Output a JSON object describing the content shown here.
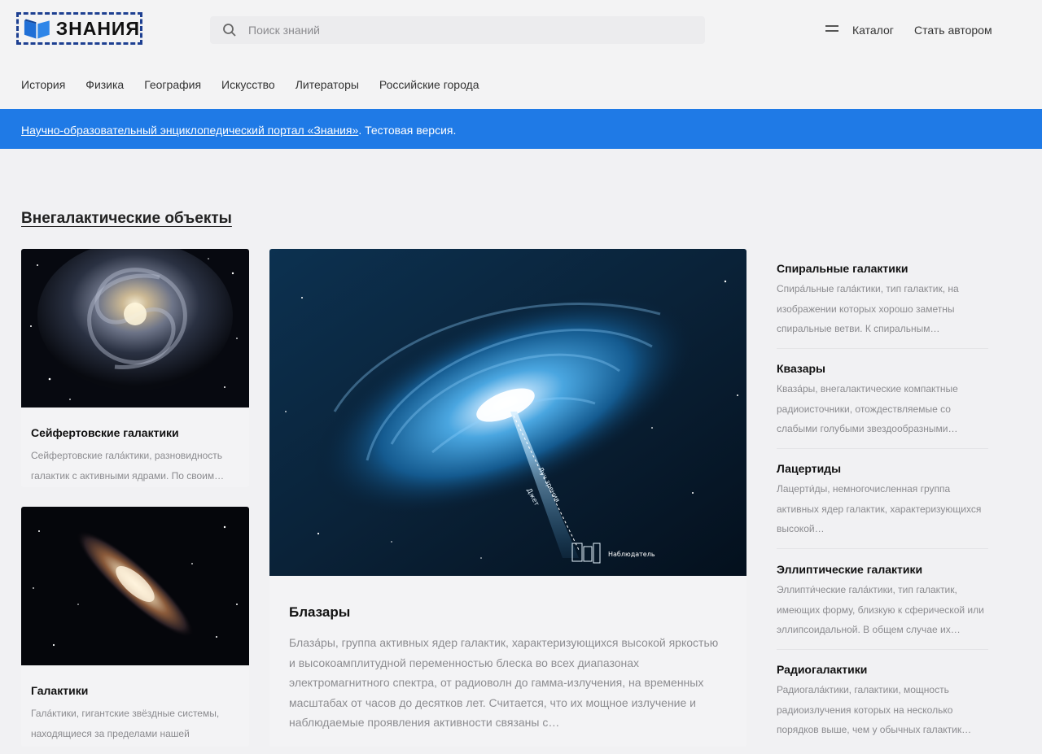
{
  "header": {
    "logo_text": "ЗНАНИЯ",
    "search_placeholder": "Поиск знаний",
    "catalog_label": "Каталог",
    "become_author_label": "Стать автором"
  },
  "nav": {
    "items": [
      "История",
      "Физика",
      "География",
      "Искусство",
      "Литераторы",
      "Российские города"
    ]
  },
  "banner": {
    "link_text": "Научно-образовательный энциклопедический портал «Знания»",
    "rest_text": ". Тестовая версия."
  },
  "section": {
    "title": "Внегалактические объекты"
  },
  "cards": {
    "seyfert": {
      "title": "Сейфертовские галактики",
      "desc": "Сейфертовские гала́ктики, разновидность галактик с активными ядрами. По своим…"
    },
    "galaxies": {
      "title": "Галактики",
      "desc": "Гала́ктики, гигантские звёздные системы, находящиеся за пределами нашей Галактик…"
    },
    "blazars": {
      "title": "Блазары",
      "desc": "Блаза́ры, группа активных ядер галактик, характеризующихся высокой яркостью и высокоамплитудной переменностью блеска во всех диапазонах электромагнитного спектра, от радиоволн до гамма-излучения, на временных масштабах от часов до десятков лет. Считается, что их мощное излучение и наблюдаемые проявления активности связаны с…",
      "image_labels": {
        "line_of_sight": "Луч зрения",
        "jet": "Джет",
        "observer": "Наблюдатель"
      }
    }
  },
  "side": {
    "items": [
      {
        "title": "Спиральные галактики",
        "desc": "Спира́льные гала́ктики, тип галактик, на изображении которых хорошо заметны спиральные ветви. К спиральным…"
      },
      {
        "title": "Квазары",
        "desc": "Кваза́ры, внегалактические компактные радиоисточники, отождествляемые со слабыми голубыми звездообразными…"
      },
      {
        "title": "Лацертиды",
        "desc": "Лацерти́ды, немногочисленная группа активных ядер галактик, характеризующихся высокой…"
      },
      {
        "title": "Эллиптические галактики",
        "desc": "Эллипти́ческие гала́ктики, тип галактик, имеющих форму, близкую к сферической или эллипсоидальной. В общем случае их…"
      },
      {
        "title": "Радиогалактики",
        "desc": "Радиогала́ктики, галактики, мощность радиоизлучения которых на несколько порядков выше, чем у обычных галактик…"
      }
    ]
  },
  "colors": {
    "banner": "#1f7ae6",
    "logo_border": "#1d3f91",
    "page_bg": "#f1f1f3"
  }
}
